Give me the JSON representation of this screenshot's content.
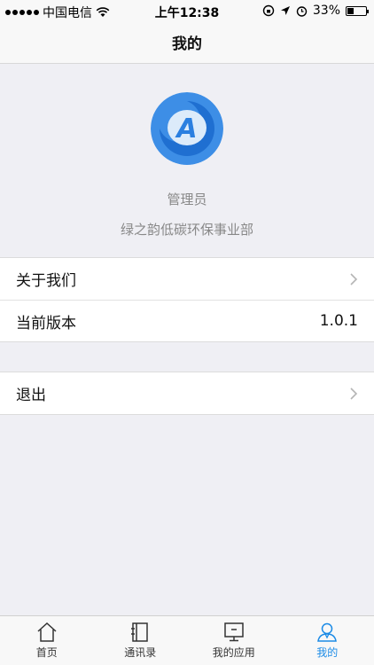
{
  "status": {
    "carrier": "中国电信",
    "time": "上午12:38",
    "battery": "33%",
    "battery_level": 0.33
  },
  "nav": {
    "title": "我的"
  },
  "profile": {
    "name": "管理员",
    "department": "绿之韵低碳环保事业部",
    "logo_letter": "A"
  },
  "menu": {
    "about_label": "关于我们",
    "version_label": "当前版本",
    "version_value": "1.0.1",
    "logout_label": "退出"
  },
  "tabs": [
    {
      "label": "首页",
      "icon": "home-icon"
    },
    {
      "label": "通讯录",
      "icon": "contacts-icon"
    },
    {
      "label": "我的应用",
      "icon": "monitor-icon"
    },
    {
      "label": "我的",
      "icon": "user-icon"
    }
  ],
  "colors": {
    "accent": "#1c8be6",
    "background": "#efeff4"
  }
}
